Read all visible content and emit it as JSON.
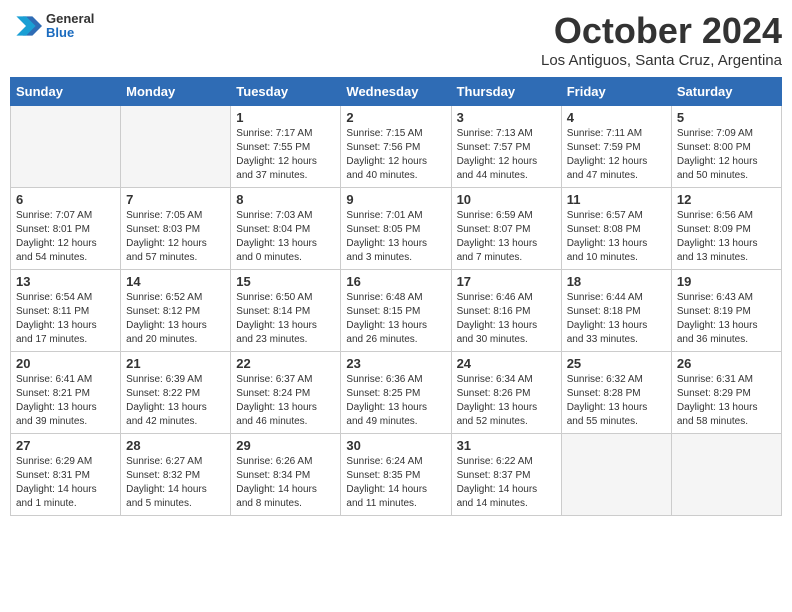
{
  "header": {
    "logo": {
      "general": "General",
      "blue": "Blue"
    },
    "title": "October 2024",
    "location": "Los Antiguos, Santa Cruz, Argentina"
  },
  "days_of_week": [
    "Sunday",
    "Monday",
    "Tuesday",
    "Wednesday",
    "Thursday",
    "Friday",
    "Saturday"
  ],
  "weeks": [
    [
      {
        "day": "",
        "info": ""
      },
      {
        "day": "",
        "info": ""
      },
      {
        "day": "1",
        "info": "Sunrise: 7:17 AM\nSunset: 7:55 PM\nDaylight: 12 hours\nand 37 minutes."
      },
      {
        "day": "2",
        "info": "Sunrise: 7:15 AM\nSunset: 7:56 PM\nDaylight: 12 hours\nand 40 minutes."
      },
      {
        "day": "3",
        "info": "Sunrise: 7:13 AM\nSunset: 7:57 PM\nDaylight: 12 hours\nand 44 minutes."
      },
      {
        "day": "4",
        "info": "Sunrise: 7:11 AM\nSunset: 7:59 PM\nDaylight: 12 hours\nand 47 minutes."
      },
      {
        "day": "5",
        "info": "Sunrise: 7:09 AM\nSunset: 8:00 PM\nDaylight: 12 hours\nand 50 minutes."
      }
    ],
    [
      {
        "day": "6",
        "info": "Sunrise: 7:07 AM\nSunset: 8:01 PM\nDaylight: 12 hours\nand 54 minutes."
      },
      {
        "day": "7",
        "info": "Sunrise: 7:05 AM\nSunset: 8:03 PM\nDaylight: 12 hours\nand 57 minutes."
      },
      {
        "day": "8",
        "info": "Sunrise: 7:03 AM\nSunset: 8:04 PM\nDaylight: 13 hours\nand 0 minutes."
      },
      {
        "day": "9",
        "info": "Sunrise: 7:01 AM\nSunset: 8:05 PM\nDaylight: 13 hours\nand 3 minutes."
      },
      {
        "day": "10",
        "info": "Sunrise: 6:59 AM\nSunset: 8:07 PM\nDaylight: 13 hours\nand 7 minutes."
      },
      {
        "day": "11",
        "info": "Sunrise: 6:57 AM\nSunset: 8:08 PM\nDaylight: 13 hours\nand 10 minutes."
      },
      {
        "day": "12",
        "info": "Sunrise: 6:56 AM\nSunset: 8:09 PM\nDaylight: 13 hours\nand 13 minutes."
      }
    ],
    [
      {
        "day": "13",
        "info": "Sunrise: 6:54 AM\nSunset: 8:11 PM\nDaylight: 13 hours\nand 17 minutes."
      },
      {
        "day": "14",
        "info": "Sunrise: 6:52 AM\nSunset: 8:12 PM\nDaylight: 13 hours\nand 20 minutes."
      },
      {
        "day": "15",
        "info": "Sunrise: 6:50 AM\nSunset: 8:14 PM\nDaylight: 13 hours\nand 23 minutes."
      },
      {
        "day": "16",
        "info": "Sunrise: 6:48 AM\nSunset: 8:15 PM\nDaylight: 13 hours\nand 26 minutes."
      },
      {
        "day": "17",
        "info": "Sunrise: 6:46 AM\nSunset: 8:16 PM\nDaylight: 13 hours\nand 30 minutes."
      },
      {
        "day": "18",
        "info": "Sunrise: 6:44 AM\nSunset: 8:18 PM\nDaylight: 13 hours\nand 33 minutes."
      },
      {
        "day": "19",
        "info": "Sunrise: 6:43 AM\nSunset: 8:19 PM\nDaylight: 13 hours\nand 36 minutes."
      }
    ],
    [
      {
        "day": "20",
        "info": "Sunrise: 6:41 AM\nSunset: 8:21 PM\nDaylight: 13 hours\nand 39 minutes."
      },
      {
        "day": "21",
        "info": "Sunrise: 6:39 AM\nSunset: 8:22 PM\nDaylight: 13 hours\nand 42 minutes."
      },
      {
        "day": "22",
        "info": "Sunrise: 6:37 AM\nSunset: 8:24 PM\nDaylight: 13 hours\nand 46 minutes."
      },
      {
        "day": "23",
        "info": "Sunrise: 6:36 AM\nSunset: 8:25 PM\nDaylight: 13 hours\nand 49 minutes."
      },
      {
        "day": "24",
        "info": "Sunrise: 6:34 AM\nSunset: 8:26 PM\nDaylight: 13 hours\nand 52 minutes."
      },
      {
        "day": "25",
        "info": "Sunrise: 6:32 AM\nSunset: 8:28 PM\nDaylight: 13 hours\nand 55 minutes."
      },
      {
        "day": "26",
        "info": "Sunrise: 6:31 AM\nSunset: 8:29 PM\nDaylight: 13 hours\nand 58 minutes."
      }
    ],
    [
      {
        "day": "27",
        "info": "Sunrise: 6:29 AM\nSunset: 8:31 PM\nDaylight: 14 hours\nand 1 minute."
      },
      {
        "day": "28",
        "info": "Sunrise: 6:27 AM\nSunset: 8:32 PM\nDaylight: 14 hours\nand 5 minutes."
      },
      {
        "day": "29",
        "info": "Sunrise: 6:26 AM\nSunset: 8:34 PM\nDaylight: 14 hours\nand 8 minutes."
      },
      {
        "day": "30",
        "info": "Sunrise: 6:24 AM\nSunset: 8:35 PM\nDaylight: 14 hours\nand 11 minutes."
      },
      {
        "day": "31",
        "info": "Sunrise: 6:22 AM\nSunset: 8:37 PM\nDaylight: 14 hours\nand 14 minutes."
      },
      {
        "day": "",
        "info": ""
      },
      {
        "day": "",
        "info": ""
      }
    ]
  ]
}
